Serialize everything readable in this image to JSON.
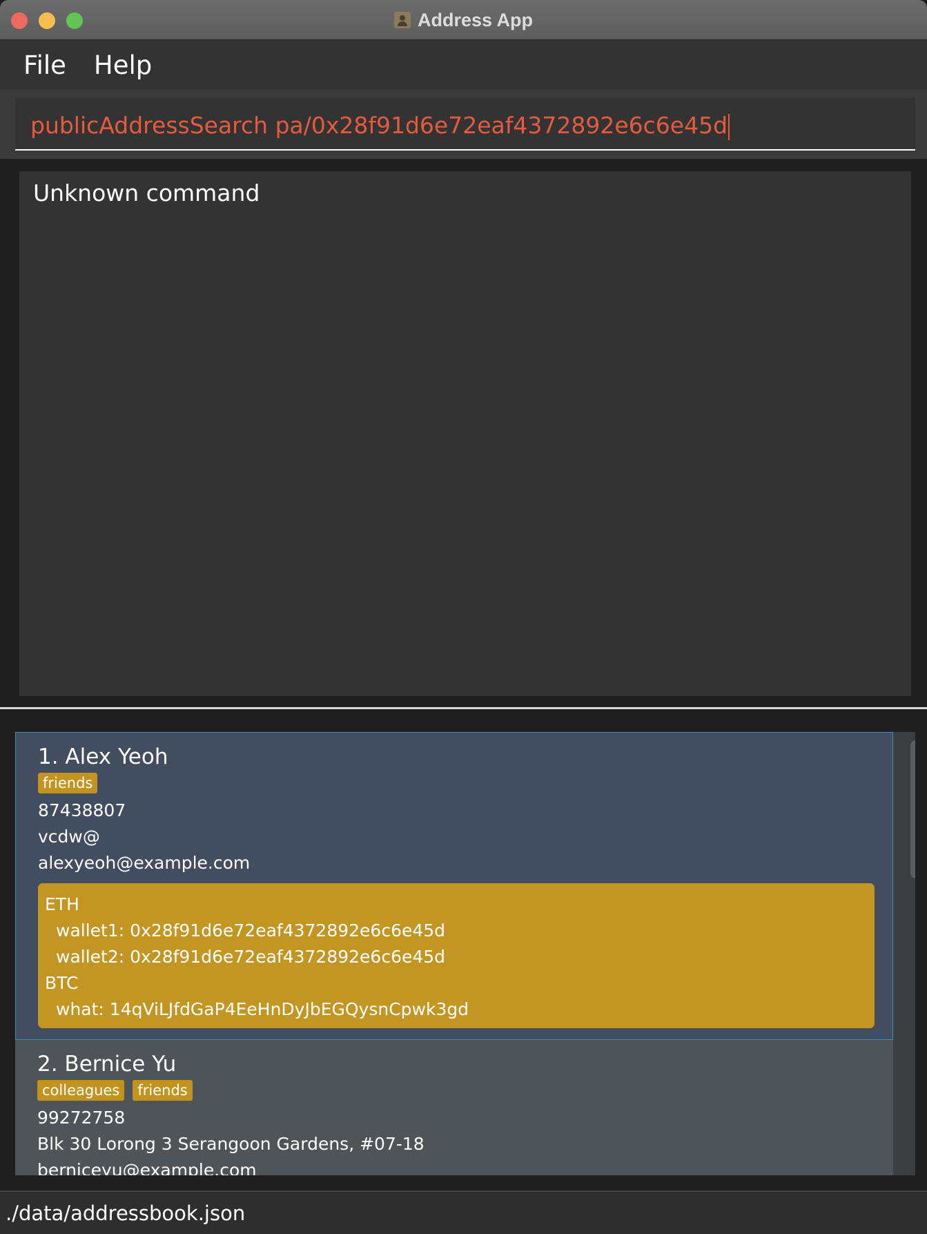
{
  "window": {
    "title": "Address App"
  },
  "menu": {
    "file": "File",
    "help": "Help"
  },
  "command": {
    "value": "publicAddressSearch pa/0x28f91d6e72eaf4372892e6c6e45d"
  },
  "result": {
    "message": "Unknown command"
  },
  "persons": [
    {
      "name": "1. Alex Yeoh",
      "tags": [
        "friends"
      ],
      "phone": "87438807",
      "address": "vcdw@",
      "email": "alexyeoh@example.com",
      "wallets": [
        "ETH",
        "wallet1: 0x28f91d6e72eaf4372892e6c6e45d",
        "wallet2: 0x28f91d6e72eaf4372892e6c6e45d",
        "BTC",
        "what: 14qViLJfdGaP4EeHnDyJbEGQysnCpwk3gd"
      ]
    },
    {
      "name": "2. Bernice Yu",
      "tags": [
        "colleagues",
        "friends"
      ],
      "phone": "99272758",
      "address": "Blk 30 Lorong 3 Serangoon Gardens, #07-18",
      "email": "berniceyu@example.com"
    }
  ],
  "status": {
    "path": "./data/addressbook.json"
  },
  "colors": {
    "tag": "#c3931f",
    "command_text": "#e65b3f",
    "selected_border": "#3d8fb8"
  }
}
